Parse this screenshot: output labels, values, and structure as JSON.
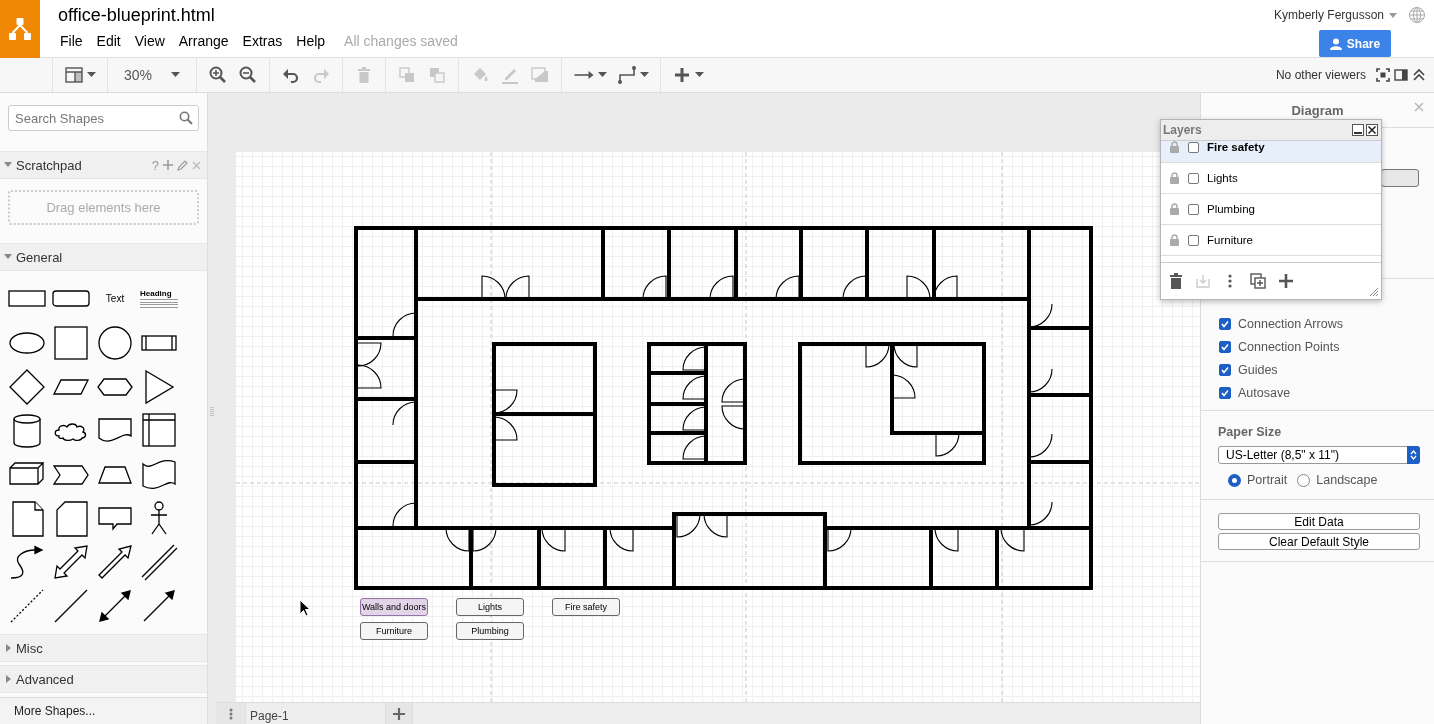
{
  "header": {
    "title": "office-blueprint.html",
    "menu": [
      {
        "label": "File"
      },
      {
        "label": "Edit"
      },
      {
        "label": "View"
      },
      {
        "label": "Arrange"
      },
      {
        "label": "Extras"
      },
      {
        "label": "Help"
      }
    ],
    "save_status": "All changes saved",
    "user": "Kymberly Fergusson",
    "share": "Share"
  },
  "toolbar": {
    "groups": [
      {
        "tools": [
          {
            "kind": "format",
            "disabled": false,
            "dropdown": true
          }
        ]
      },
      {
        "tools": [
          {
            "kind": "zoom",
            "label": "30%",
            "disabled": false,
            "dropdown": true
          }
        ]
      },
      {
        "tools": [
          {
            "kind": "zoom-in",
            "disabled": false,
            "dropdown": false
          },
          {
            "kind": "zoom-out",
            "disabled": false,
            "dropdown": false
          }
        ]
      },
      {
        "tools": [
          {
            "kind": "undo",
            "disabled": false,
            "dropdown": false
          },
          {
            "kind": "redo",
            "disabled": true,
            "dropdown": false
          }
        ]
      },
      {
        "tools": [
          {
            "kind": "delete",
            "disabled": true,
            "dropdown": false
          }
        ]
      },
      {
        "tools": [
          {
            "kind": "to-front",
            "disabled": true,
            "dropdown": false
          },
          {
            "kind": "to-back",
            "disabled": true,
            "dropdown": false
          }
        ]
      },
      {
        "tools": [
          {
            "kind": "fill",
            "disabled": true,
            "dropdown": false
          },
          {
            "kind": "line",
            "disabled": true,
            "dropdown": false
          },
          {
            "kind": "shadow",
            "disabled": true,
            "dropdown": false
          }
        ]
      },
      {
        "tools": [
          {
            "kind": "connection",
            "disabled": false,
            "dropdown": true
          },
          {
            "kind": "waypoints",
            "disabled": false,
            "dropdown": true
          }
        ]
      },
      {
        "tools": [
          {
            "kind": "insert",
            "disabled": false,
            "dropdown": true
          }
        ]
      }
    ],
    "viewers": "No other viewers"
  },
  "sidebar": {
    "search": {
      "placeholder": "Search Shapes"
    },
    "scratchpad": {
      "title": "Scratchpad",
      "expanded": true,
      "help": "?",
      "drop_hint": "Drag elements here"
    },
    "general": {
      "title": "General",
      "expanded": true,
      "shapes": [
        {
          "kind": "rect"
        },
        {
          "kind": "rounded"
        },
        {
          "kind": "text",
          "label": "Text"
        },
        {
          "kind": "heading",
          "label": "Heading"
        },
        {
          "kind": "ellipse"
        },
        {
          "kind": "square"
        },
        {
          "kind": "circle"
        },
        {
          "kind": "process"
        },
        {
          "kind": "diamond"
        },
        {
          "kind": "parallelogram"
        },
        {
          "kind": "hexagon"
        },
        {
          "kind": "triangle"
        },
        {
          "kind": "cylinder"
        },
        {
          "kind": "cloud"
        },
        {
          "kind": "document"
        },
        {
          "kind": "internal-storage"
        },
        {
          "kind": "cube"
        },
        {
          "kind": "step"
        },
        {
          "kind": "trapezoid"
        },
        {
          "kind": "tape"
        },
        {
          "kind": "note"
        },
        {
          "kind": "card"
        },
        {
          "kind": "callout"
        },
        {
          "kind": "actor"
        },
        {
          "kind": "curve"
        },
        {
          "kind": "double-arrow"
        },
        {
          "kind": "arrow"
        },
        {
          "kind": "link"
        },
        {
          "kind": "dashed-line"
        },
        {
          "kind": "line"
        },
        {
          "kind": "double-connector"
        },
        {
          "kind": "connector"
        }
      ]
    },
    "sections": [
      {
        "title": "Misc",
        "expanded": false
      },
      {
        "title": "Advanced",
        "expanded": false
      }
    ],
    "more_shapes": "More Shapes..."
  },
  "canvas": {
    "layer_buttons": [
      {
        "label": "Walls and doors",
        "selected": true
      },
      {
        "label": "Lights",
        "selected": false
      },
      {
        "label": "Fire safety",
        "selected": false
      },
      {
        "label": "Furniture",
        "selected": false
      },
      {
        "label": "Plumbing",
        "selected": false
      }
    ],
    "pages": [
      {
        "label": "Page-1"
      }
    ]
  },
  "format_panel": {
    "title": "Diagram",
    "options": [
      {
        "label": "Connection Arrows",
        "checked": true
      },
      {
        "label": "Connection Points",
        "checked": true
      },
      {
        "label": "Guides",
        "checked": true
      },
      {
        "label": "Autosave",
        "checked": true
      }
    ],
    "paper_size": {
      "label": "Paper Size",
      "value": "US-Letter (8,5\" x 11\")"
    },
    "orientation": [
      {
        "label": "Portrait",
        "selected": true
      },
      {
        "label": "Landscape",
        "selected": false
      }
    ],
    "buttons": [
      {
        "label": "Edit Data"
      },
      {
        "label": "Clear Default Style"
      }
    ]
  },
  "layers_window": {
    "title": "Layers",
    "layers": [
      {
        "name": "Fire safety",
        "selected": true,
        "checked": false
      },
      {
        "name": "Lights",
        "selected": false,
        "checked": false
      },
      {
        "name": "Plumbing",
        "selected": false,
        "checked": false
      },
      {
        "name": "Furniture",
        "selected": false,
        "checked": false
      }
    ]
  }
}
